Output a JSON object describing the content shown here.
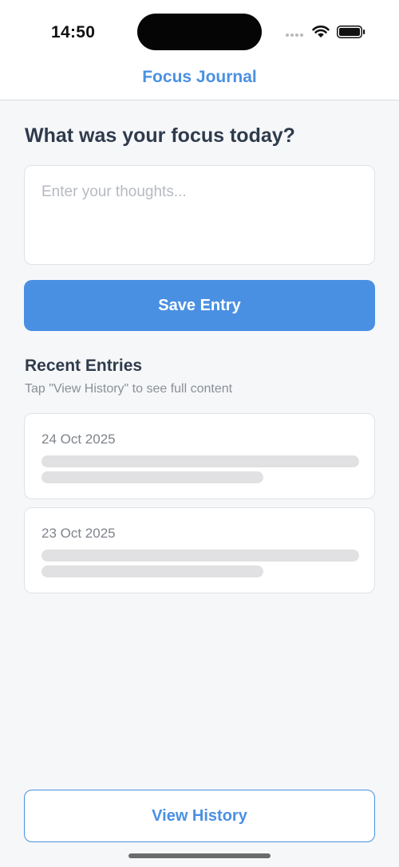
{
  "status_bar": {
    "time": "14:50",
    "icons": [
      "cellular-signal-icon",
      "wifi-icon",
      "battery-icon"
    ]
  },
  "nav": {
    "title": "Focus Journal"
  },
  "main": {
    "prompt": "What was your focus today?",
    "input": {
      "value": "",
      "placeholder": "Enter your thoughts..."
    },
    "save_label": "Save Entry"
  },
  "recent": {
    "title": "Recent Entries",
    "subtitle": "Tap \"View History\" to see full content",
    "entries": [
      {
        "date": "24 Oct 2025"
      },
      {
        "date": "23 Oct 2025"
      }
    ]
  },
  "footer": {
    "history_label": "View History"
  },
  "colors": {
    "accent": "#4a90e2",
    "text_primary": "#2f3b4c",
    "text_secondary": "#8a8f96",
    "background": "#f6f7f9"
  }
}
